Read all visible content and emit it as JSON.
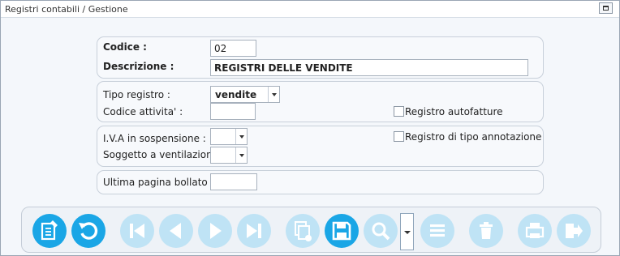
{
  "window": {
    "title": "Registri contabili / Gestione",
    "restore_icon": "restore-window-icon"
  },
  "header": {
    "codice_label": "Codice :",
    "codice_value": "02",
    "descrizione_label": "Descrizione :",
    "descrizione_value": "REGISTRI DELLE VENDITE"
  },
  "tipo": {
    "tipo_registro_label": "Tipo registro :",
    "tipo_registro_value": "vendite",
    "codice_attivita_label": "Codice attivita' :",
    "codice_attivita_value": "",
    "autofatture_label": "Registro autofatture",
    "autofatture_checked": false
  },
  "iva": {
    "sospensione_label": "I.V.A in sospensione :",
    "sospensione_value": "",
    "ventilazione_label": "Soggetto a ventilazione :",
    "ventilazione_value": "",
    "annotazione_label": "Registro di tipo annotazione",
    "annotazione_checked": false
  },
  "bollato": {
    "label": "Ultima pagina bollato :",
    "value": ""
  },
  "toolbar": {
    "buttons": [
      {
        "name": "new-record",
        "icon": "new-document-icon",
        "enabled": true
      },
      {
        "name": "undo",
        "icon": "undo-icon",
        "enabled": true
      },
      {
        "name": "first-record",
        "icon": "first-icon",
        "enabled": false
      },
      {
        "name": "previous-record",
        "icon": "previous-icon",
        "enabled": false
      },
      {
        "name": "next-record",
        "icon": "next-icon",
        "enabled": false
      },
      {
        "name": "last-record",
        "icon": "last-icon",
        "enabled": false
      },
      {
        "name": "duplicate",
        "icon": "copy-document-icon",
        "enabled": false
      },
      {
        "name": "save",
        "icon": "save-icon",
        "enabled": true
      },
      {
        "name": "search",
        "icon": "search-icon",
        "enabled": false
      },
      {
        "name": "list",
        "icon": "list-icon",
        "enabled": false
      },
      {
        "name": "delete",
        "icon": "trash-icon",
        "enabled": false
      },
      {
        "name": "print",
        "icon": "print-icon",
        "enabled": false
      },
      {
        "name": "exit",
        "icon": "exit-icon",
        "enabled": false
      }
    ]
  },
  "colors": {
    "accent": "#1aa6e6",
    "disabled": "#bfe3f5",
    "window_bg": "#f4f7fb",
    "section_border": "#c8d0da"
  }
}
